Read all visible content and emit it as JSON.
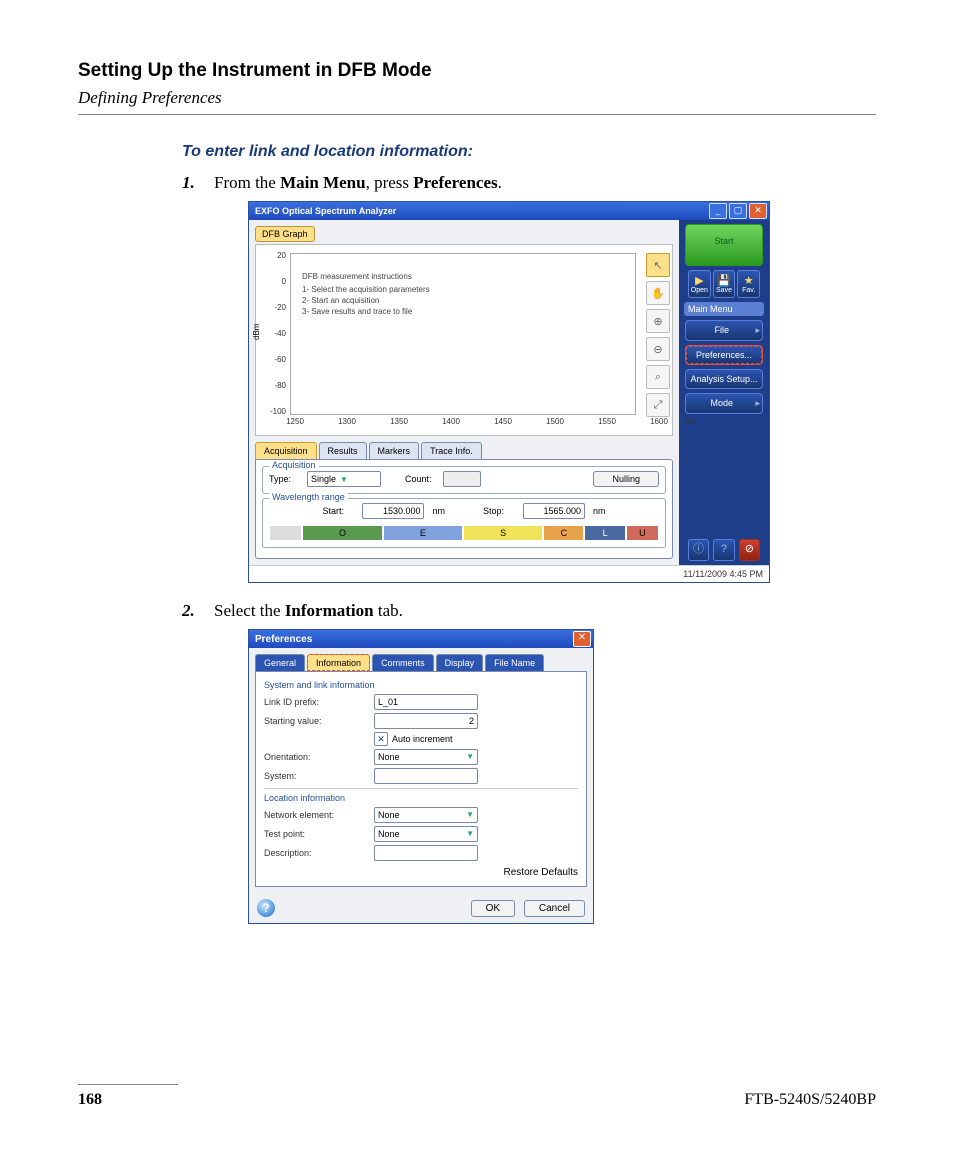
{
  "page": {
    "chapter_title": "Setting Up the Instrument in DFB Mode",
    "section_sub": "Defining Preferences",
    "task_heading": "To enter link and location information:",
    "step1_a": "From the ",
    "step1_b": "Main Menu",
    "step1_c": ", press ",
    "step1_d": "Preferences",
    "step1_e": ".",
    "step2_a": "Select the ",
    "step2_b": "Information",
    "step2_c": " tab.",
    "page_number": "168",
    "model": "FTB-5240S/5240BP"
  },
  "app": {
    "title": "EXFO Optical Spectrum Analyzer",
    "graph_tab": "DFB Graph",
    "y_label": "dBm",
    "y_ticks": [
      "20",
      "0",
      "-20",
      "-40",
      "-60",
      "-80",
      "-100"
    ],
    "x_ticks": [
      "1250",
      "1300",
      "1350",
      "1400",
      "1450",
      "1500",
      "1550",
      "1600",
      "nm"
    ],
    "note_header": "DFB measurement instructions",
    "note_lines": [
      "1- Select the acquisition parameters",
      "2- Start an acquisition",
      "3- Save results and trace to file"
    ],
    "tool_arrow": "↖",
    "tool_hand": "✋",
    "tool_zin": "⊕",
    "tool_zout": "⊖",
    "tool_zbox": "⌕",
    "tool_full": "⤢",
    "tabs2": {
      "acq": "Acquisition",
      "res": "Results",
      "mark": "Markers",
      "ti": "Trace Info."
    },
    "acq_legend": "Acquisition",
    "acq_type_label": "Type:",
    "acq_type_value": "Single",
    "acq_count_label": "Count:",
    "nulling": "Nulling",
    "wl_legend": "Wavelength range",
    "wl_start_label": "Start:",
    "wl_start_value": "1530.000",
    "wl_stop_label": "Stop:",
    "wl_stop_value": "1565.000",
    "nm": "nm",
    "bands": {
      "O": "O",
      "E": "E",
      "S": "S",
      "C": "C",
      "L": "L",
      "U": "U"
    },
    "status_time": "11/11/2009 4:45 PM",
    "r_start": "Start",
    "r_open": "Open",
    "r_open_g": "▶",
    "r_save": "Save",
    "r_save_g": "💾",
    "r_fav": "Fav.",
    "r_fav_g": "★",
    "r_mainmenu": "Main Menu",
    "r_file": "File",
    "r_prefs": "Preferences...",
    "r_ansetup": "Analysis Setup...",
    "r_mode": "Mode",
    "r_info": "ⓘ",
    "r_help": "?",
    "r_close": "⊘"
  },
  "dlg": {
    "title": "Preferences",
    "tabs": {
      "gen": "General",
      "info": "Information",
      "com": "Comments",
      "disp": "Display",
      "fn": "File Name"
    },
    "grp1": "System and link information",
    "link_prefix_label": "Link ID prefix:",
    "link_prefix_value": "L_01",
    "start_val_label": "Starting value:",
    "start_val_value": "2",
    "auto_inc": "Auto increment",
    "orient_label": "Orientation:",
    "orient_value": "None",
    "system_label": "System:",
    "grp2": "Location information",
    "ne_label": "Network element:",
    "ne_value": "None",
    "tp_label": "Test point:",
    "tp_value": "None",
    "desc_label": "Description:",
    "restore": "Restore Defaults",
    "ok": "OK",
    "cancel": "Cancel",
    "help": "?"
  }
}
